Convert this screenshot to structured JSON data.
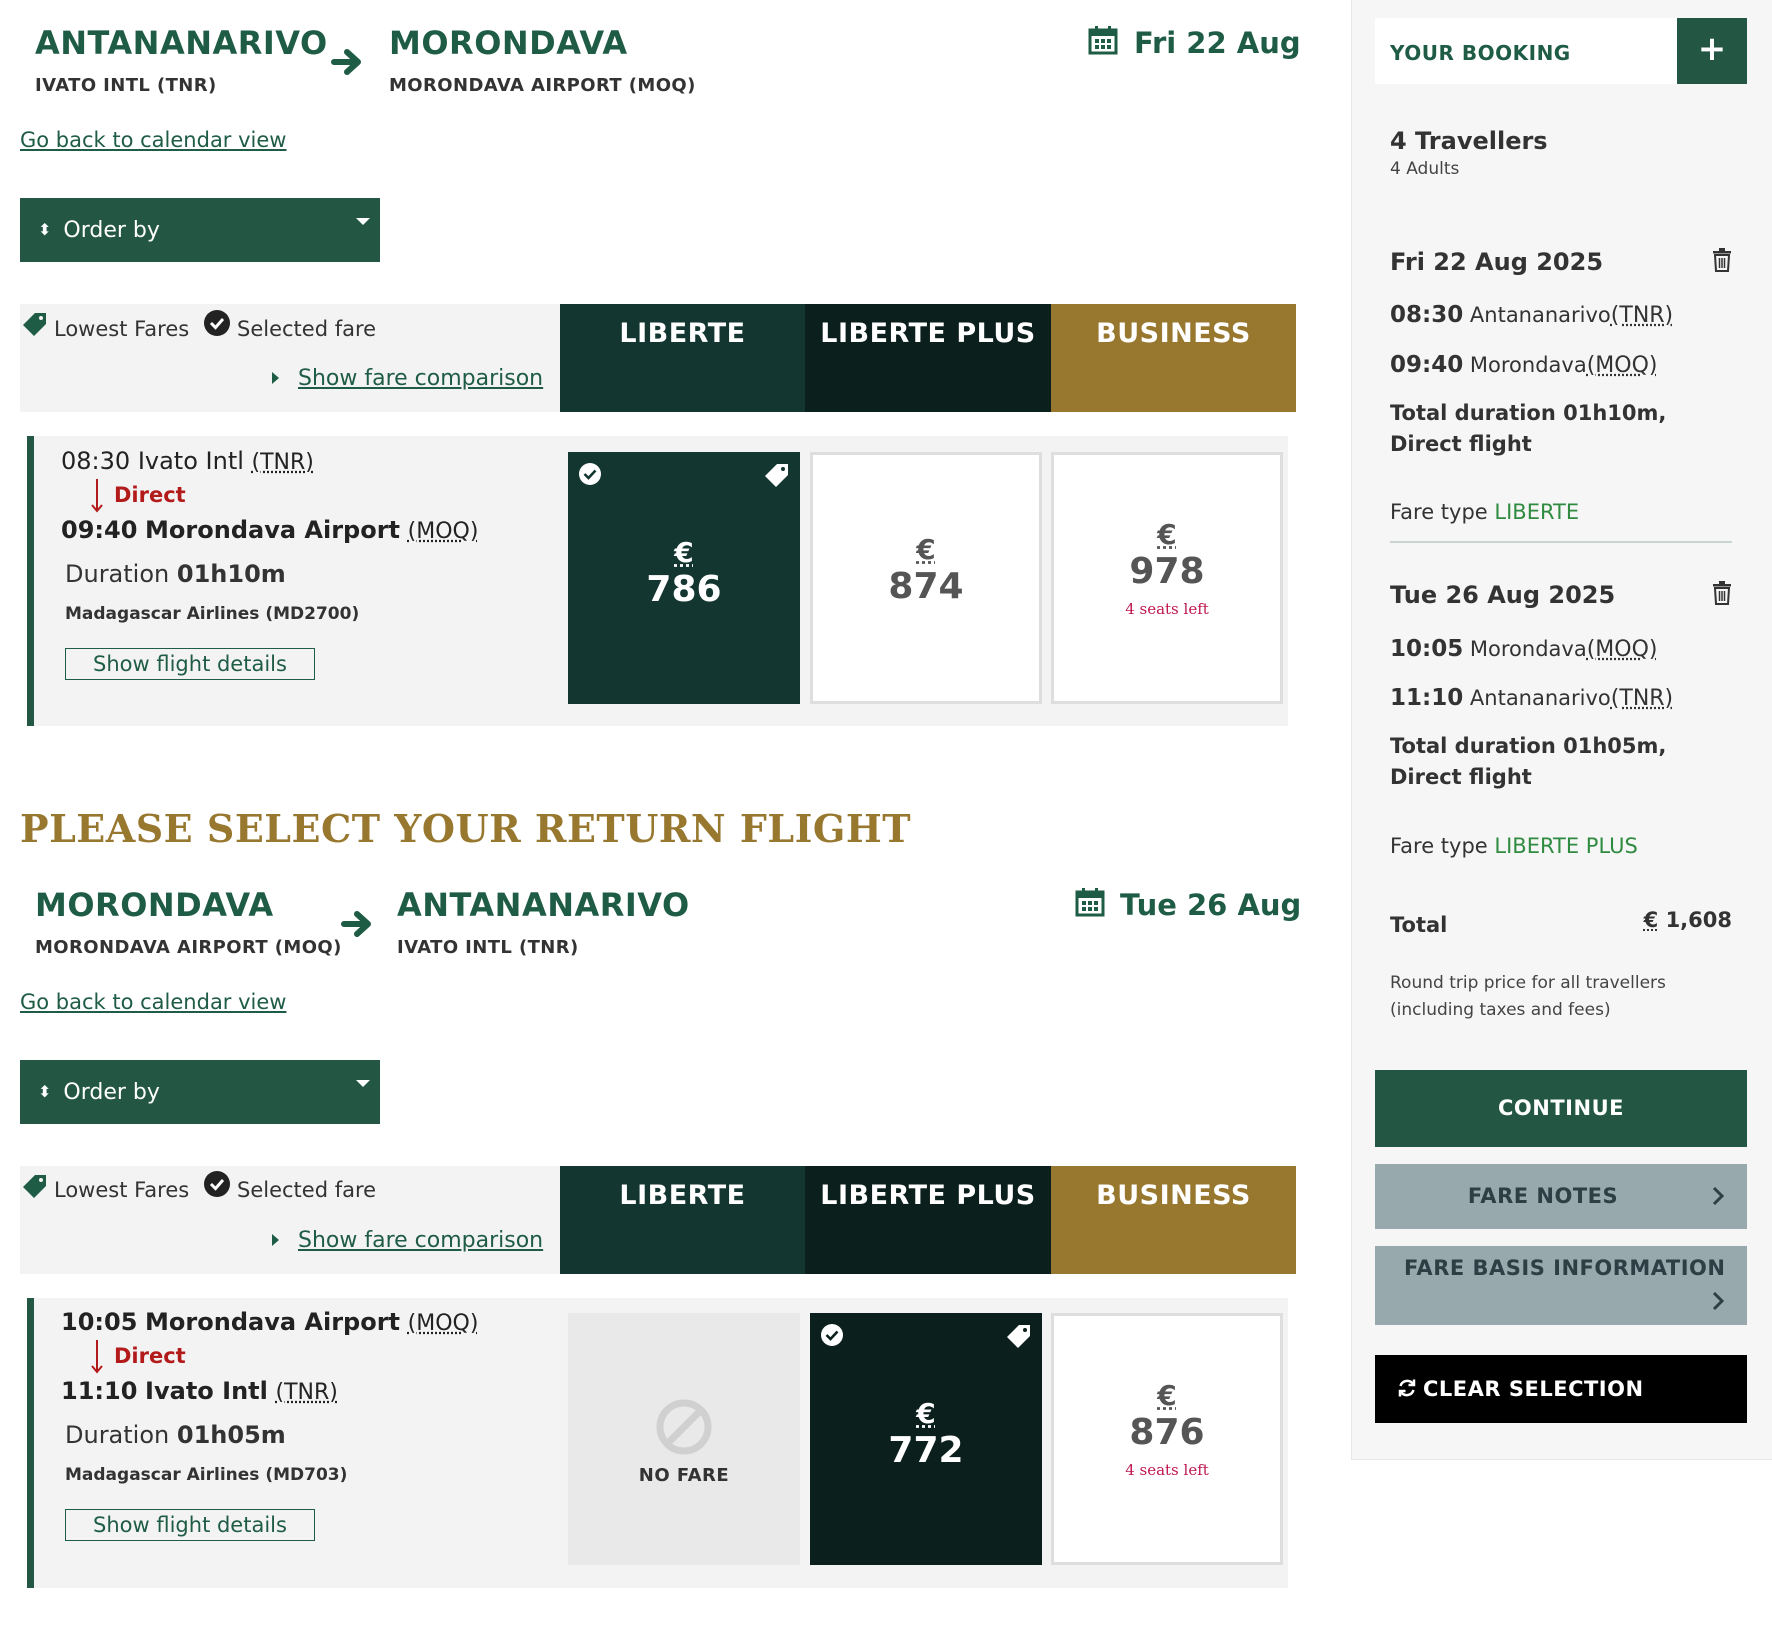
{
  "outbound": {
    "from_city": "ANTANANARIVO",
    "from_airport": "IVATO INTL (TNR)",
    "to_city": "MORONDAVA",
    "to_airport": "MORONDAVA AIRPORT (MOQ)",
    "date": "Fri 22 Aug",
    "back_link": "Go back to calendar view",
    "order_by": "Order by",
    "legend": {
      "lowest": "Lowest Fares",
      "selected": "Selected fare",
      "compare": "Show fare comparison"
    },
    "fare_headers": [
      "LIBERTE",
      "LIBERTE PLUS",
      "BUSINESS"
    ],
    "flight": {
      "dep_time": "08:30",
      "dep_name": "Ivato Intl",
      "dep_code": "(TNR)",
      "direct": "Direct",
      "arr_time": "09:40",
      "arr_name": "Morondava Airport",
      "arr_code": "(MOQ)",
      "duration_label": "Duration",
      "duration": "01h10m",
      "airline": "Madagascar Airlines (MD2700)",
      "details_btn": "Show flight details"
    },
    "fares": [
      {
        "currency": "€",
        "amount": "786",
        "state": "selected"
      },
      {
        "currency": "€",
        "amount": "874",
        "state": "available"
      },
      {
        "currency": "€",
        "amount": "978",
        "seats": "4 seats left",
        "state": "available"
      }
    ]
  },
  "return_title": "PLEASE SELECT YOUR RETURN FLIGHT",
  "inbound": {
    "from_city": "MORONDAVA",
    "from_airport": "MORONDAVA AIRPORT (MOQ)",
    "to_city": "ANTANANARIVO",
    "to_airport": "IVATO INTL (TNR)",
    "date": "Tue 26 Aug",
    "back_link": "Go back to calendar view",
    "order_by": "Order by",
    "legend": {
      "lowest": "Lowest Fares",
      "selected": "Selected fare",
      "compare": "Show fare comparison"
    },
    "fare_headers": [
      "LIBERTE",
      "LIBERTE PLUS",
      "BUSINESS"
    ],
    "flight": {
      "dep_time": "10:05",
      "dep_name": "Morondava Airport",
      "dep_code": "(MOQ)",
      "direct": "Direct",
      "arr_time": "11:10",
      "arr_name": "Ivato Intl",
      "arr_code": "(TNR)",
      "duration_label": "Duration",
      "duration": "01h05m",
      "airline": "Madagascar Airlines (MD703)",
      "details_btn": "Show flight details"
    },
    "fares": [
      {
        "label": "NO FARE",
        "state": "unavailable"
      },
      {
        "currency": "€",
        "amount": "772",
        "state": "selected"
      },
      {
        "currency": "€",
        "amount": "876",
        "seats": "4 seats left",
        "state": "available"
      }
    ]
  },
  "sidebar": {
    "title": "YOUR BOOKING",
    "plus": "+",
    "travellers": "4 Travellers",
    "adults": "4 Adults",
    "leg1": {
      "date": "Fri 22 Aug 2025",
      "dep_time": "08:30",
      "dep_city": "Antananarivo",
      "dep_code": "(TNR)",
      "arr_time": "09:40",
      "arr_city": "Morondava",
      "arr_code": "(MOQ)",
      "total_duration": "Total duration 01h10m, Direct flight",
      "fare_label": "Fare type",
      "fare_type": "LIBERTE"
    },
    "leg2": {
      "date": "Tue 26 Aug 2025",
      "dep_time": "10:05",
      "dep_city": "Morondava",
      "dep_code": "(MOQ)",
      "arr_time": "11:10",
      "arr_city": "Antananarivo",
      "arr_code": "(TNR)",
      "total_duration": "Total duration 01h05m, Direct flight",
      "fare_label": "Fare type",
      "fare_type": "LIBERTE PLUS"
    },
    "total_label": "Total",
    "total_currency": "€",
    "total_value": "1,608",
    "total_note": "Round trip price for all travellers (including taxes and fees)",
    "continue": "CONTINUE",
    "fare_notes": "FARE NOTES",
    "fare_basis": "FARE BASIS INFORMATION",
    "clear": "CLEAR SELECTION"
  },
  "colors": {
    "brand_green": "#235744",
    "liberte": "#133630",
    "liberte_plus": "#0b1f1c",
    "business": "#98772f",
    "direct_red": "#b31b1b",
    "seats_pink": "#c0164f"
  }
}
